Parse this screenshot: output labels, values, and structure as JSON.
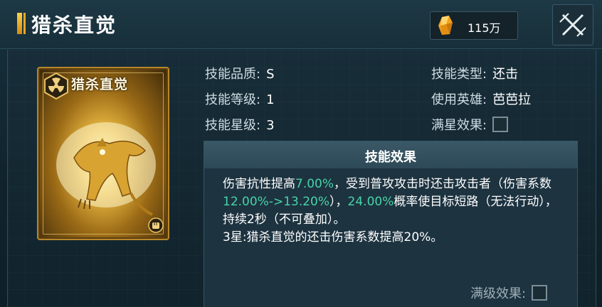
{
  "header": {
    "title": "猎杀直觉",
    "currency_value": "115万",
    "currency_icon": "gold-crystal-icon",
    "close_icon": "close-icon"
  },
  "card": {
    "title": "猎杀直觉",
    "emblem_icon": "radiation-emblem-icon",
    "art": "golden-panther-art",
    "badge_icon": "fist-icon"
  },
  "stats": {
    "quality_label": "技能品质:",
    "quality_value": "S",
    "level_label": "技能等级:",
    "level_value": "1",
    "star_label": "技能星级:",
    "star_value": "3",
    "type_label": "技能类型:",
    "type_value": "还击",
    "hero_label": "使用英雄:",
    "hero_value": "芭芭拉",
    "full_star_label": "满星效果:",
    "full_star_checked": false
  },
  "effect": {
    "title": "技能效果",
    "p1_a": "伤害抗性提高",
    "p1_hl1": "7.00%",
    "p1_b": "，受到普攻攻击时还击攻击者（伤害系数",
    "p1_hl2": "12.00%->13.20%",
    "p1_c": "），",
    "p1_hl3": "24.00%",
    "p1_d": "概率使目标短路（无法行动），持续2秒（不可叠加）。",
    "p2": "3星:猎杀直觉的还击伤害系数提高20%。",
    "max_level_label": "满级效果:",
    "max_level_checked": false
  },
  "colors": {
    "highlight": "#48d4a8",
    "accent_gold": "#e9a824",
    "panel_bg": "#1d3340"
  }
}
